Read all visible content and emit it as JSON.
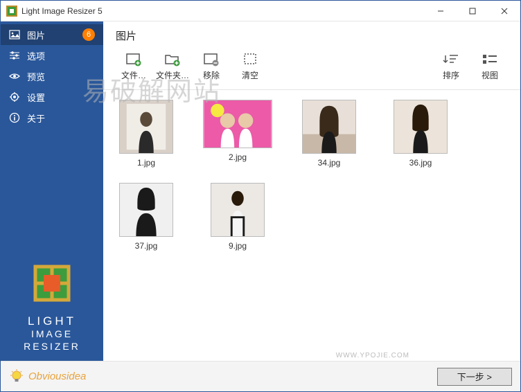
{
  "window": {
    "title": "Light Image Resizer 5"
  },
  "sidebar": {
    "items": [
      {
        "label": "图片",
        "badge": "6",
        "active": true
      },
      {
        "label": "选项"
      },
      {
        "label": "预览"
      },
      {
        "label": "设置"
      },
      {
        "label": "关于"
      }
    ],
    "brand": {
      "line1": "LIGHT",
      "line2": "IMAGE",
      "line3": "RESIZER"
    }
  },
  "main": {
    "header": "图片",
    "toolbar": {
      "file": "文件…",
      "folder": "文件夹…",
      "remove": "移除",
      "clear": "清空",
      "sort": "排序",
      "view": "视图"
    },
    "watermark": "易破解网站",
    "thumbs": [
      {
        "label": "1.jpg",
        "landscape": false
      },
      {
        "label": "2.jpg",
        "landscape": true
      },
      {
        "label": "34.jpg",
        "landscape": false
      },
      {
        "label": "36.jpg",
        "landscape": false
      },
      {
        "label": "37.jpg",
        "landscape": false
      },
      {
        "label": "9.jpg",
        "landscape": false
      }
    ]
  },
  "footer": {
    "brand": "Obviousidea",
    "url": "WWW.YPOJIE.COM",
    "next": "下一步 >"
  }
}
